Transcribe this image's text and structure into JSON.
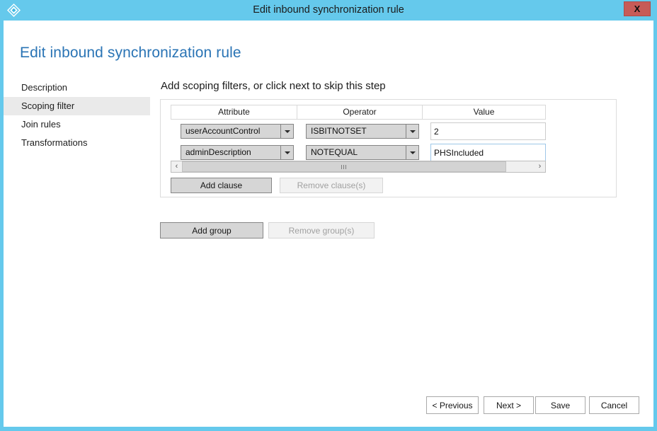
{
  "window": {
    "title": "Edit inbound synchronization rule",
    "icon": "sync-rule-diamond-icon",
    "close_label": "X",
    "accent_color": "#65c9ec",
    "close_color": "#c75b57"
  },
  "page": {
    "heading": "Edit inbound synchronization rule",
    "heading_color": "#2a74b5"
  },
  "sidebar": {
    "items": [
      {
        "label": "Description",
        "selected": false
      },
      {
        "label": "Scoping filter",
        "selected": true
      },
      {
        "label": "Join rules",
        "selected": false
      },
      {
        "label": "Transformations",
        "selected": false
      }
    ],
    "selected_background": "#eaeaea"
  },
  "main": {
    "instruction": "Add scoping filters, or click next to skip this step",
    "table": {
      "columns": [
        "Attribute",
        "Operator",
        "Value"
      ],
      "rows": [
        {
          "attribute": "userAccountControl",
          "operator": "ISBITNOTSET",
          "value": "2",
          "value_focused": false
        },
        {
          "attribute": "adminDescription",
          "operator": "NOTEQUAL",
          "value": "PHSIncluded",
          "value_focused": true
        }
      ]
    },
    "scrollbar": {
      "left_arrow": "‹",
      "right_arrow": "›",
      "orientation": "horizontal"
    },
    "clause_buttons": [
      {
        "label": "Add clause",
        "enabled": true
      },
      {
        "label": "Remove clause(s)",
        "enabled": false
      }
    ],
    "group_buttons": [
      {
        "label": "Add group",
        "enabled": true
      },
      {
        "label": "Remove group(s)",
        "enabled": false
      }
    ]
  },
  "footer": {
    "previous_label": "< Previous",
    "next_label": "Next >",
    "save_label": "Save",
    "cancel_label": "Cancel"
  }
}
